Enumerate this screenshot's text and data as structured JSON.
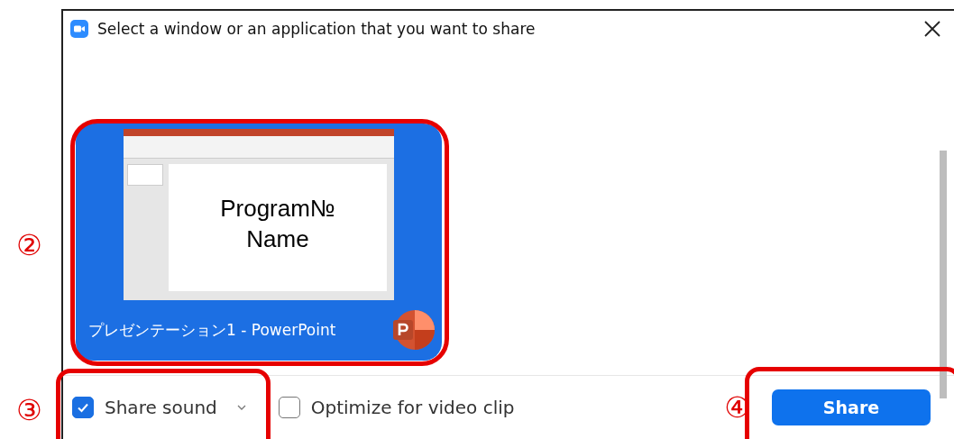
{
  "window": {
    "title": "Select a window or an application that you want to share"
  },
  "windows": [
    {
      "caption": "プレゼンテーション1 - PowerPoint",
      "slide_text": "Program№\nName",
      "selected": true
    }
  ],
  "options": [
    {
      "kind": "checkbox",
      "label": "Share sound",
      "checked": true,
      "has_menu": true
    },
    {
      "kind": "checkbox",
      "label": "Optimize for video clip",
      "checked": false,
      "has_menu": false
    }
  ],
  "share_button": {
    "label": "Share"
  },
  "annotations": [
    {
      "label": "②"
    },
    {
      "label": "③"
    },
    {
      "label": "④"
    }
  ]
}
